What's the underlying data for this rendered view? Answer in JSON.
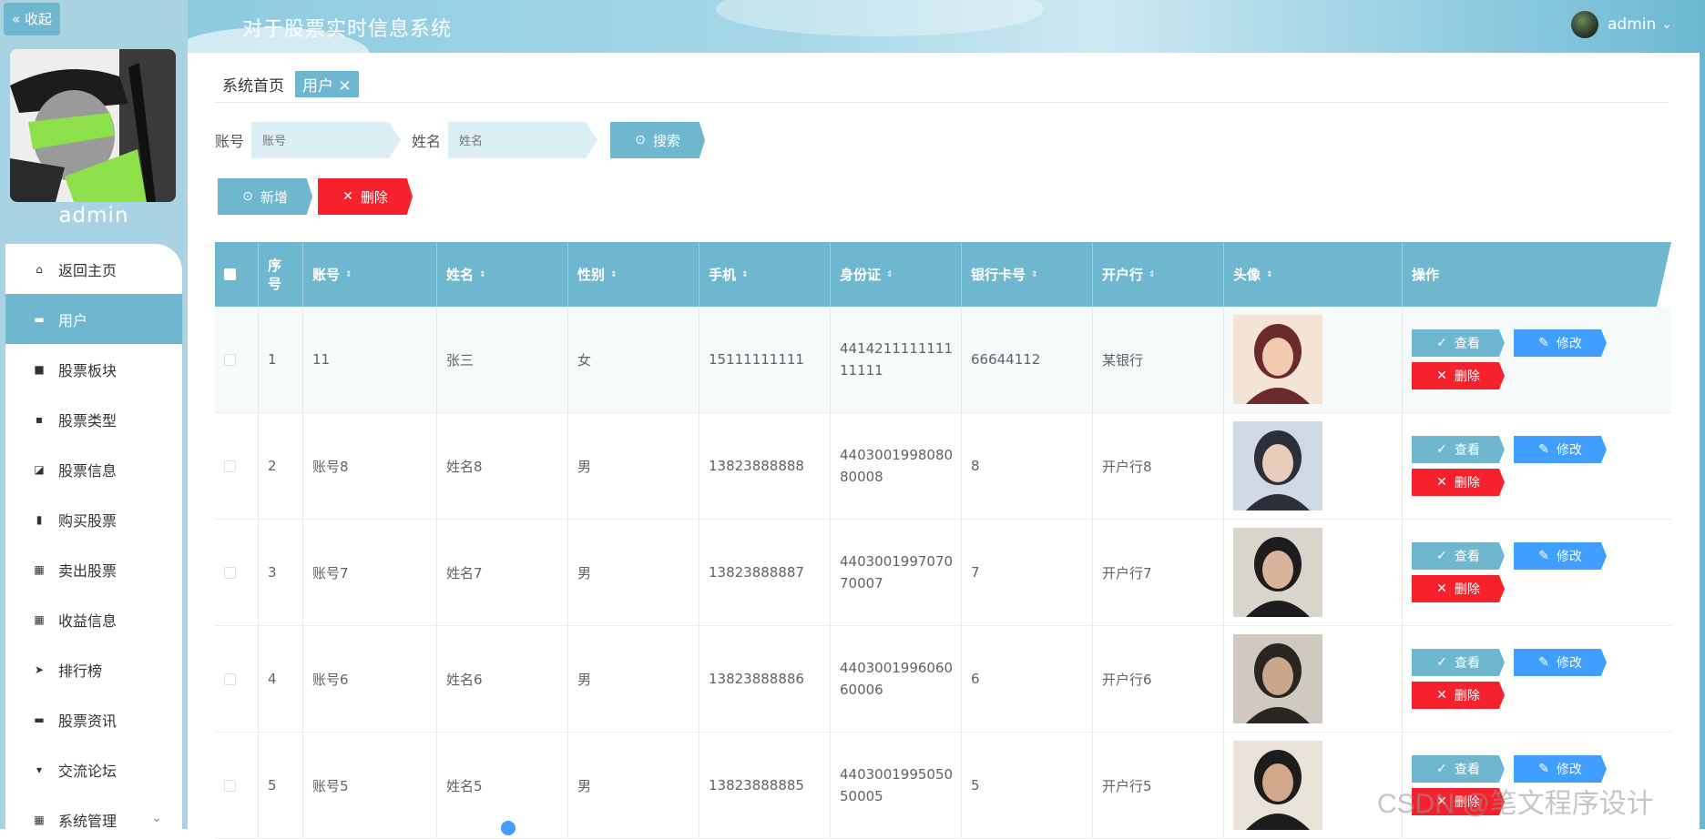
{
  "sidebar": {
    "collapse_label": "« 收起",
    "username": "admin",
    "items": [
      {
        "label": "返回主页",
        "icon": "home-icon"
      },
      {
        "label": "用户",
        "icon": "monitor-icon"
      },
      {
        "label": "股票板块",
        "icon": "video-icon"
      },
      {
        "label": "股票类型",
        "icon": "chat-icon"
      },
      {
        "label": "股票信息",
        "icon": "chart-icon"
      },
      {
        "label": "购买股票",
        "icon": "book-icon"
      },
      {
        "label": "卖出股票",
        "icon": "grid-icon"
      },
      {
        "label": "收益信息",
        "icon": "grid-icon"
      },
      {
        "label": "排行榜",
        "icon": "send-icon"
      },
      {
        "label": "股票资讯",
        "icon": "briefcase-icon"
      },
      {
        "label": "交流论坛",
        "icon": "cup-icon"
      },
      {
        "label": "系统管理",
        "icon": "grid-icon"
      }
    ]
  },
  "header": {
    "title": "对于股票实时信息系统",
    "user": "admin",
    "user_caret": "⌄"
  },
  "breadcrumb": {
    "home": "系统首页",
    "current": "用户 ✕"
  },
  "search": {
    "account_label": "账号",
    "account_placeholder": "账号",
    "name_label": "姓名",
    "name_placeholder": "姓名",
    "search_button": "搜索"
  },
  "actions": {
    "add": "新增",
    "delete": "删除"
  },
  "table": {
    "columns": [
      "序号",
      "账号",
      "姓名",
      "性别",
      "手机",
      "身份证",
      "银行卡号",
      "开户行",
      "头像",
      "操作"
    ],
    "op_view": "查看",
    "op_edit": "修改",
    "op_delete": "删除",
    "rows": [
      {
        "idx": "1",
        "account": "11",
        "name": "张三",
        "gender": "女",
        "phone": "15111111111",
        "id_card": "441421111111111111",
        "bank_card": "66644112",
        "bank": "某银行"
      },
      {
        "idx": "2",
        "account": "账号8",
        "name": "姓名8",
        "gender": "男",
        "phone": "13823888888",
        "id_card": "440300199808080008",
        "bank_card": "8",
        "bank": "开户行8"
      },
      {
        "idx": "3",
        "account": "账号7",
        "name": "姓名7",
        "gender": "男",
        "phone": "13823888887",
        "id_card": "440300199707070007",
        "bank_card": "7",
        "bank": "开户行7"
      },
      {
        "idx": "4",
        "account": "账号6",
        "name": "姓名6",
        "gender": "男",
        "phone": "13823888886",
        "id_card": "440300199606060006",
        "bank_card": "6",
        "bank": "开户行6"
      },
      {
        "idx": "5",
        "account": "账号5",
        "name": "姓名5",
        "gender": "男",
        "phone": "13823888885",
        "id_card": "440300199505050005",
        "bank_card": "5",
        "bank": "开户行5"
      }
    ]
  },
  "watermark": "CSDN @笔文程序设计",
  "colors": {
    "primary": "#6fb6cf",
    "danger": "#f5222d",
    "edit": "#409eff"
  }
}
